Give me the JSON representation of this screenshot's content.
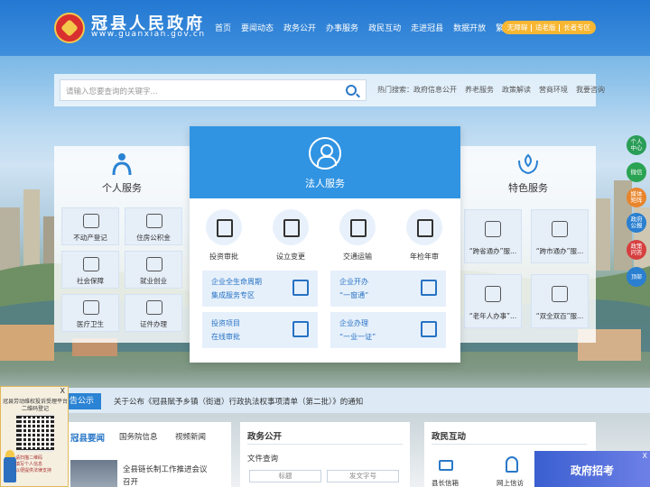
{
  "header": {
    "title": "冠县人民政府",
    "url": "www.guanxian.gov.cn",
    "nav": [
      "首页",
      "要闻动态",
      "政务公开",
      "办事服务",
      "政民互动",
      "走进冠县",
      "数据开放",
      "繁"
    ],
    "access": [
      "无障碍",
      "适老版",
      "长者专区"
    ]
  },
  "search": {
    "placeholder": "请输入您要查询的关键字...",
    "hot_label": "热门搜索：政府信息公开",
    "hot_items": [
      "养老服务",
      "政策解读",
      "营商环境",
      "我要咨询"
    ]
  },
  "personal": {
    "title": "个人服务",
    "items": [
      "不动产登记",
      "住房公积金",
      "社会保障",
      "就业创业",
      "医疗卫生",
      "证件办理"
    ]
  },
  "legal": {
    "title": "法人服务",
    "icons": [
      "投资审批",
      "设立变更",
      "交通运输",
      "年检年审"
    ],
    "cards": [
      {
        "line1": "企业全生命周期",
        "line2": "集成服务专区"
      },
      {
        "line1": "企业开办",
        "line2": "“一窗通”"
      },
      {
        "line1": "投资项目",
        "line2": "在线审批"
      },
      {
        "line1": "企业办理",
        "line2": "“一业一证”"
      }
    ]
  },
  "special": {
    "title": "特色服务",
    "items": [
      "“跨省通办”服...",
      "“跨市通办”服...",
      "“老年人办事”...",
      "“双全双百”服..."
    ]
  },
  "sidebar": [
    "个人中心",
    "微信",
    "媒体矩阵",
    "政府公报",
    "政策问答",
    "顶部"
  ],
  "notice": {
    "tag": "公告公示",
    "text": "关于公布《冠县賦予乡镇（街道）行政执法权事项清单（第二批）》的通知"
  },
  "news": {
    "tabs": [
      "冠县要闻",
      "国务院信息",
      "视频新闻"
    ],
    "headline_1": "全县链长制工作推进会议",
    "headline_2": "召开"
  },
  "gov_open": {
    "title": "政务公开",
    "subtitle": "文件查询",
    "field_1": "标题",
    "field_2": "发文字号"
  },
  "interact": {
    "title": "政民互动",
    "items": [
      "县长信箱",
      "网上信访"
    ]
  },
  "floating_ad": {
    "close": "X",
    "title": "冠县劳动维权投诉受理平台二维码登记",
    "notes": [
      "请扫描二维码",
      "填写个人信息",
      "以便提供法律支持"
    ]
  },
  "recruit": {
    "label": "政府招考",
    "close": "X"
  },
  "colors": {
    "header": "#2378d1",
    "accent": "#3194e2",
    "access": "#f7b733"
  }
}
